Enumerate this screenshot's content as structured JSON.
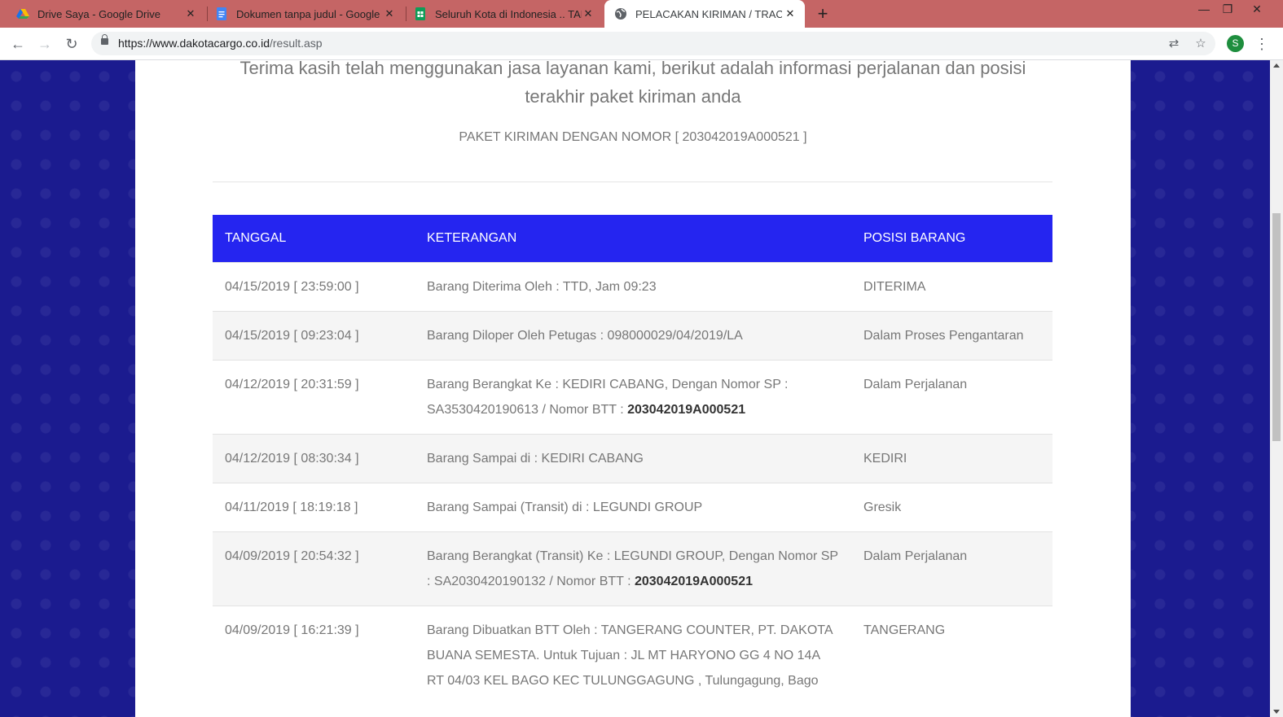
{
  "browser": {
    "tabs": [
      {
        "title": "Drive Saya - Google Drive",
        "icon": "google-drive-icon"
      },
      {
        "title": "Dokumen tanpa judul - Google D",
        "icon": "google-docs-icon"
      },
      {
        "title": "Seluruh Kota di Indonesia .. TANG",
        "icon": "google-sheets-icon"
      },
      {
        "title": "PELACAKAN KIRIMAN / TRACING",
        "icon": "globe-icon"
      }
    ],
    "url_host": "https://www.dakotacargo.co.id",
    "url_path": "/result.asp",
    "profile_initial": "S",
    "new_tab": "+",
    "close": "✕"
  },
  "page": {
    "intro": "Terima kasih telah menggunakan jasa layanan kami, berikut adalah informasi perjalanan dan posisi terakhir paket kiriman anda",
    "reference": "PAKET KIRIMAN DENGAN NOMOR [ 203042019A000521 ]",
    "table": {
      "headers": [
        "TANGGAL",
        "KETERANGAN",
        "POSISI BARANG"
      ],
      "rows": [
        {
          "date": "04/15/2019 [ 23:59:00 ]",
          "desc": "Barang Diterima Oleh : TTD, Jam 09:23",
          "desc_bold": "",
          "pos": "DITERIMA"
        },
        {
          "date": "04/15/2019 [ 09:23:04 ]",
          "desc": "Barang Diloper Oleh Petugas : 098000029/04/2019/LA",
          "desc_bold": "",
          "pos": "Dalam Proses Pengantaran"
        },
        {
          "date": "04/12/2019 [ 20:31:59 ]",
          "desc": "Barang Berangkat Ke : KEDIRI CABANG, Dengan Nomor SP : SA3530420190613 / Nomor BTT : ",
          "desc_bold": "203042019A000521",
          "pos": "Dalam Perjalanan"
        },
        {
          "date": "04/12/2019 [ 08:30:34 ]",
          "desc": "Barang Sampai di : KEDIRI CABANG",
          "desc_bold": "",
          "pos": "KEDIRI"
        },
        {
          "date": "04/11/2019 [ 18:19:18 ]",
          "desc": "Barang Sampai (Transit) di : LEGUNDI GROUP",
          "desc_bold": "",
          "pos": "Gresik"
        },
        {
          "date": "04/09/2019 [ 20:54:32 ]",
          "desc": "Barang Berangkat (Transit) Ke : LEGUNDI GROUP, Dengan Nomor SP : SA2030420190132 / Nomor BTT : ",
          "desc_bold": "203042019A000521",
          "pos": "Dalam Perjalanan"
        },
        {
          "date": "04/09/2019 [ 16:21:39 ]",
          "desc": "Barang Dibuatkan BTT Oleh : TANGERANG COUNTER, PT. DAKOTA BUANA SEMESTA. Untuk Tujuan : JL MT HARYONO GG 4 NO 14A RT 04/03 KEL BAGO KEC TULUNGGAGUNG , Tulungagung, Bago",
          "desc_bold": "",
          "pos": "TANGERANG"
        }
      ]
    }
  },
  "colors": {
    "header_bg": "#2525f0",
    "tabstrip": "#c56565",
    "page_bg": "#1b1b8f"
  }
}
